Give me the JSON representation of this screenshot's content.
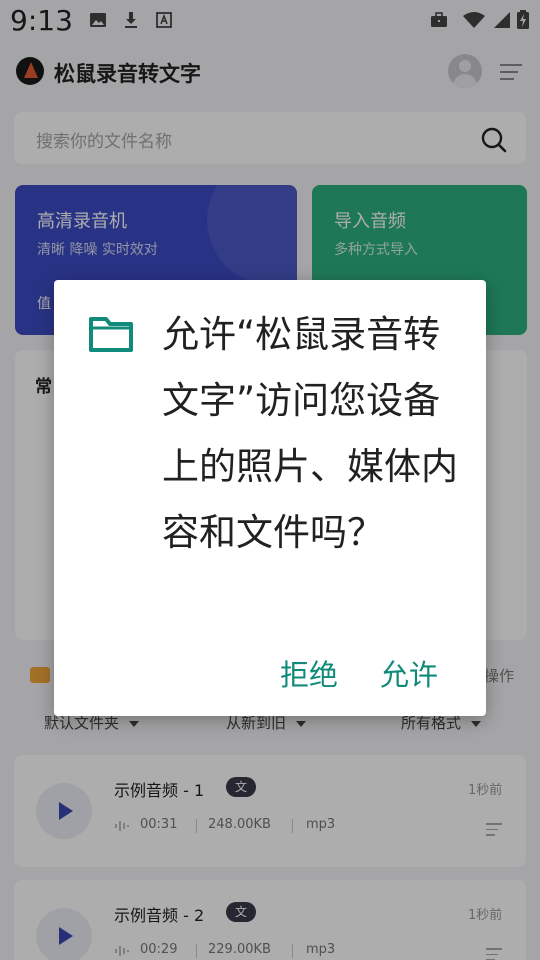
{
  "status_bar": {
    "time": "9:13",
    "icons": [
      "image-icon",
      "download-icon",
      "text-icon",
      "briefcase-icon",
      "wifi-icon",
      "signal-icon",
      "battery-charging-icon"
    ]
  },
  "header": {
    "title": "松鼠录音转文字"
  },
  "search": {
    "placeholder": "搜索你的文件名称"
  },
  "cards": [
    {
      "title": "高清录音机",
      "subtitle": "清晰 降噪 实时效对",
      "bottom": "值"
    },
    {
      "title": "导入音频",
      "subtitle": "多种方式导入"
    }
  ],
  "section": {
    "heading": "常"
  },
  "files_bar": {
    "ops_label": "操作"
  },
  "filters": [
    "默认文件夹",
    "从新到旧",
    "所有格式"
  ],
  "files": [
    {
      "name": "示例音频 - 1",
      "badge": "文",
      "time": "1秒前",
      "duration": "00:31",
      "size": "248.00KB",
      "format": "mp3"
    },
    {
      "name": "示例音频 - 2",
      "badge": "文",
      "time": "1秒前",
      "duration": "00:29",
      "size": "229.00KB",
      "format": "mp3"
    }
  ],
  "dialog": {
    "message": "允许“松鼠录音转文字”访问您设备上的照片、媒体内容和文件吗？",
    "deny_label": "拒绝",
    "allow_label": "允许"
  },
  "colors": {
    "record_card": "#3d4cc4",
    "import_card": "#2db27f",
    "dialog_accent": "#108a7a"
  }
}
